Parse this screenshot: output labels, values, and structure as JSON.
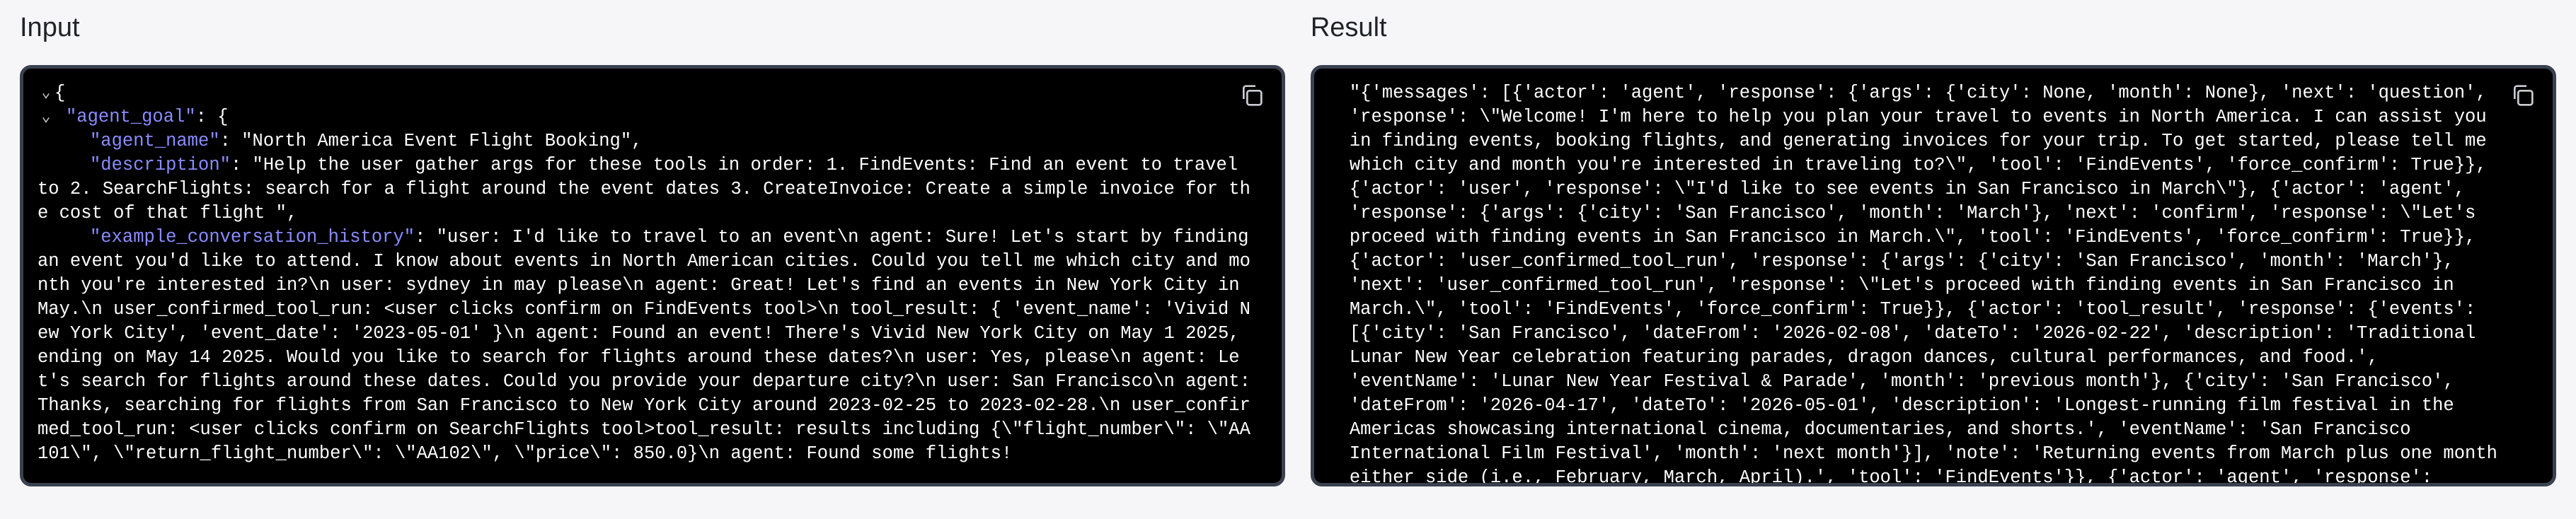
{
  "input_panel": {
    "title": "Input",
    "open_brace": "{",
    "agent_goal_key": "\"agent_goal\"",
    "agent_goal_open": ": {",
    "agent_name_key": "\"agent_name\"",
    "agent_name_value": ": \"North America Event Flight Booking\",",
    "description_key": "\"description\"",
    "description_value": ": \"Help the user gather args for these tools in order: 1. FindEvents: Find an event to travel to 2. SearchFlights: search for a flight around the event dates 3. CreateInvoice: Create a simple invoice for the cost of that flight \",",
    "history_key": "\"example_conversation_history\"",
    "history_value": ": \"user: I'd like to travel to an event\\n agent: Sure! Let's start by finding an event you'd like to attend. I know about events in North American cities. Could you tell me which city and month you're interested in?\\n user: sydney in may please\\n agent: Great! Let's find an events in New York City in May.\\n user_confirmed_tool_run: <user clicks confirm on FindEvents tool>\\n tool_result: { 'event_name': 'Vivid New York City', 'event_date': '2023-05-01' }\\n agent: Found an event! There's Vivid New York City on May 1 2025, ending on May 14 2025. Would you like to search for flights around these dates?\\n user: Yes, please\\n agent: Let's search for flights around these dates. Could you provide your departure city?\\n user: San Francisco\\n agent: Thanks, searching for flights from San Francisco to New York City around 2023-02-25 to 2023-02-28.\\n user_confirmed_tool_run: <user clicks confirm on SearchFlights tool>tool_result: results including {\\\"flight_number\\\": \\\"AA101\\\", \\\"return_flight_number\\\": \\\"AA102\\\", \\\"price\\\": 850.0}\\n agent: Found some flights!"
  },
  "result_panel": {
    "title": "Result",
    "text": "\"{'messages': [{'actor': 'agent', 'response': {'args': {'city': None, 'month': None}, 'next': 'question', 'response': \\\"Welcome! I'm here to help you plan your travel to events in North America. I can assist you in finding events, booking flights, and generating invoices for your trip. To get started, please tell me which city and month you're interested in traveling to?\\\", 'tool': 'FindEvents', 'force_confirm': True}}, {'actor': 'user', 'response': \\\"I'd like to see events in San Francisco in March\\\"}, {'actor': 'agent', 'response': {'args': {'city': 'San Francisco', 'month': 'March'}, 'next': 'confirm', 'response': \\\"Let's proceed with finding events in San Francisco in March.\\\", 'tool': 'FindEvents', 'force_confirm': True}}, {'actor': 'user_confirmed_tool_run', 'response': {'args': {'city': 'San Francisco', 'month': 'March'}, 'next': 'user_confirmed_tool_run', 'response': \\\"Let's proceed with finding events in San Francisco in March.\\\", 'tool': 'FindEvents', 'force_confirm': True}}, {'actor': 'tool_result', 'response': {'events': [{'city': 'San Francisco', 'dateFrom': '2026-02-08', 'dateTo': '2026-02-22', 'description': 'Traditional Lunar New Year celebration featuring parades, dragon dances, cultural performances, and food.', 'eventName': 'Lunar New Year Festival & Parade', 'month': 'previous month'}, {'city': 'San Francisco', 'dateFrom': '2026-04-17', 'dateTo': '2026-05-01', 'description': 'Longest-running film festival in the Americas showcasing international cinema, documentaries, and shorts.', 'eventName': 'San Francisco International Film Festival', 'month': 'next month'}], 'note': 'Returning events from March plus one month either side (i.e., February, March, April).', 'tool': 'FindEvents'}}, {'actor': 'agent', 'response': {'args':"
  },
  "icons": {
    "copy": "copy-icon",
    "collapse": "chevron-down-icon"
  },
  "colors": {
    "background": "#f6f6f8",
    "code_bg": "#000000",
    "border": "#3a4151",
    "key": "#8a8cff",
    "text": "#ffffff"
  }
}
